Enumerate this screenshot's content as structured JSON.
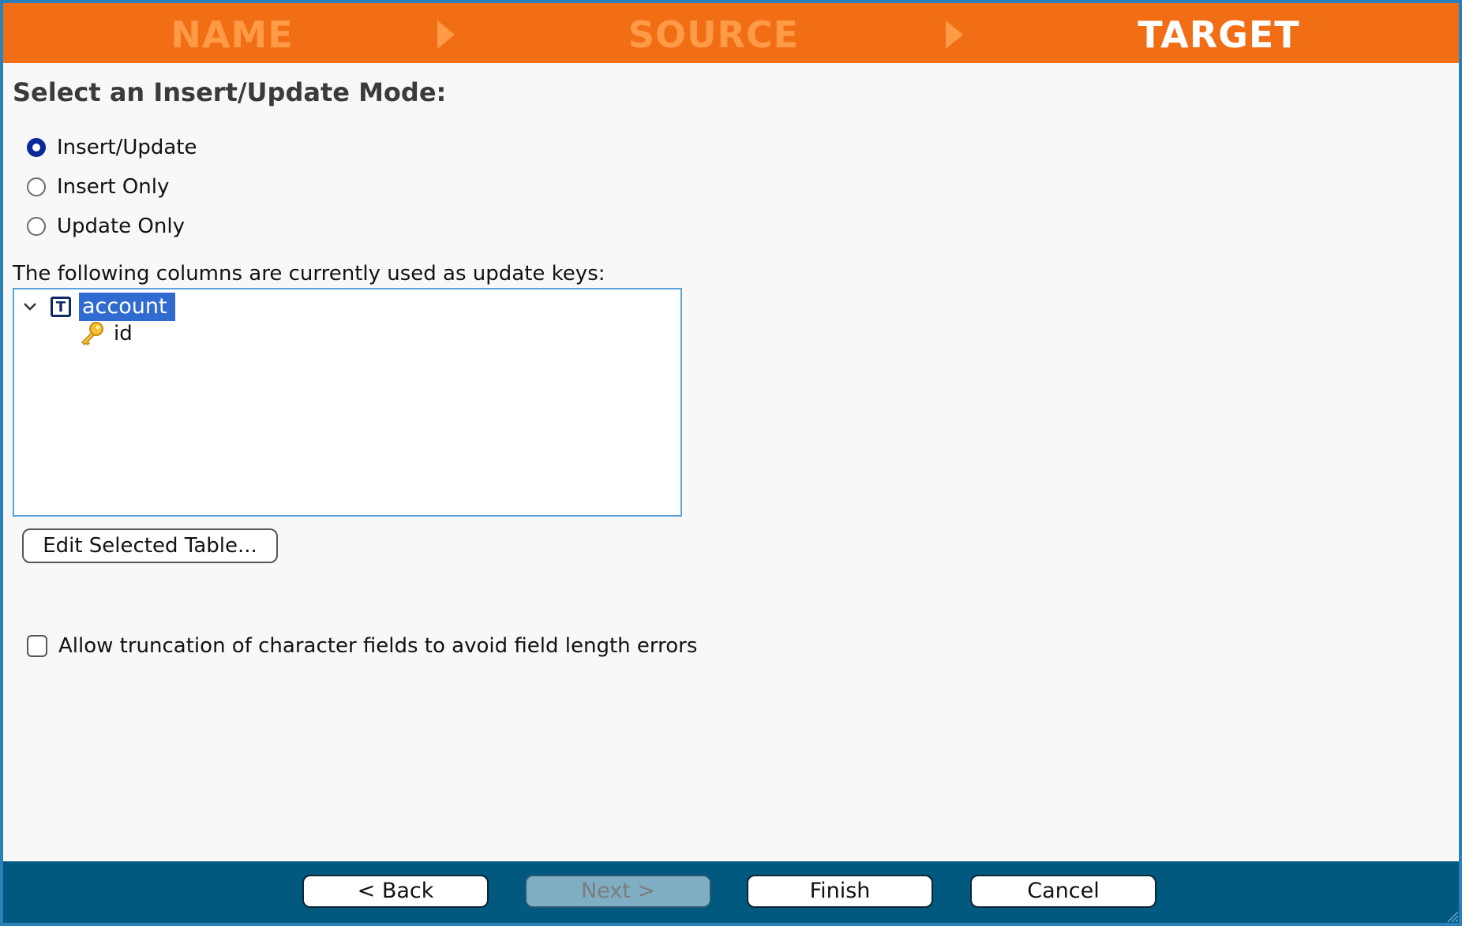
{
  "wizard_steps": [
    {
      "label": "NAME",
      "active": false
    },
    {
      "label": "SOURCE",
      "active": false
    },
    {
      "label": "TARGET",
      "active": true
    }
  ],
  "colors": {
    "header_bg": "#f26e15",
    "step_inactive": "#ff9a47",
    "step_active": "#ffffff",
    "footer_bg": "#02597f",
    "window_border": "#2a80b9",
    "selection": "#2f6bd0"
  },
  "title": "Select an Insert/Update Mode:",
  "modes": [
    {
      "label": "Insert/Update",
      "checked": true
    },
    {
      "label": "Insert Only",
      "checked": false
    },
    {
      "label": "Update Only",
      "checked": false
    }
  ],
  "keys_label": "The following columns are currently used as update keys:",
  "tree": {
    "table": {
      "label": "account",
      "icon": "table-icon",
      "expanded": true,
      "selected": true
    },
    "columns": [
      {
        "label": "id",
        "icon": "key-icon"
      }
    ]
  },
  "edit_button": "Edit Selected Table...",
  "truncation": {
    "label": "Allow truncation of character fields to avoid field length errors",
    "checked": false
  },
  "footer": {
    "back": "< Back",
    "next": "Next >",
    "next_enabled": false,
    "finish": "Finish",
    "cancel": "Cancel"
  }
}
